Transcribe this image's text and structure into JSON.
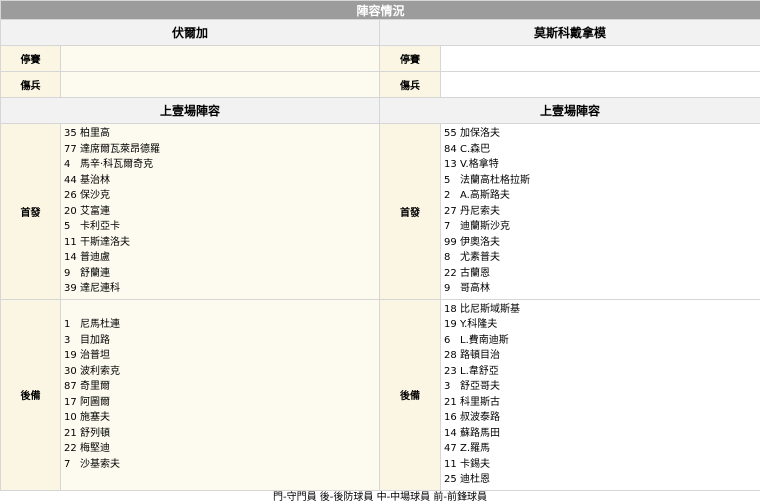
{
  "title": "陣容情況",
  "teams": {
    "home": "伏爾加",
    "away": "莫斯科戴拿模"
  },
  "labels": {
    "suspended": "停賽",
    "injured": "傷兵",
    "last_lineup": "上壹場陣容",
    "starters": "首發",
    "subs": "後備"
  },
  "home": {
    "suspended": "",
    "injured": "",
    "starters": [
      {
        "no": "35",
        "name": "柏里高"
      },
      {
        "no": "77",
        "name": "達席爾瓦萊昂德羅"
      },
      {
        "no": "4",
        "name": "馬辛·科瓦爾奇克"
      },
      {
        "no": "44",
        "name": "基治林"
      },
      {
        "no": "26",
        "name": "保沙克"
      },
      {
        "no": "20",
        "name": "艾富連"
      },
      {
        "no": "5",
        "name": "卡利亞卡"
      },
      {
        "no": "11",
        "name": "干斯達洛夫"
      },
      {
        "no": "14",
        "name": "普迪盧"
      },
      {
        "no": "9",
        "name": "舒蘭連"
      },
      {
        "no": "39",
        "name": "達尼連科"
      }
    ],
    "subs": [
      {
        "no": "1",
        "name": "尼馬杜連"
      },
      {
        "no": "3",
        "name": "目加路"
      },
      {
        "no": "19",
        "name": "治普坦"
      },
      {
        "no": "30",
        "name": "波利索克"
      },
      {
        "no": "87",
        "name": "奇里爾"
      },
      {
        "no": "17",
        "name": "阿圖爾"
      },
      {
        "no": "10",
        "name": "施塞夫"
      },
      {
        "no": "21",
        "name": "舒列頓"
      },
      {
        "no": "22",
        "name": "梅堅迪"
      },
      {
        "no": "7",
        "name": "沙基索夫"
      }
    ]
  },
  "away": {
    "suspended": "",
    "injured": "",
    "starters": [
      {
        "no": "55",
        "name": "加保洛夫"
      },
      {
        "no": "84",
        "name": "C.森巴"
      },
      {
        "no": "13",
        "name": "V.格拿特"
      },
      {
        "no": "5",
        "name": "法蘭高杜格拉斯"
      },
      {
        "no": "2",
        "name": "A.高斯路夫"
      },
      {
        "no": "27",
        "name": "丹尼索夫"
      },
      {
        "no": "7",
        "name": "迪蘭斯沙克"
      },
      {
        "no": "99",
        "name": "伊奧洛夫"
      },
      {
        "no": "8",
        "name": "尤素普夫"
      },
      {
        "no": "22",
        "name": "古蘭恩"
      },
      {
        "no": "9",
        "name": "哥高林"
      }
    ],
    "subs": [
      {
        "no": "18",
        "name": "比尼斯域斯基"
      },
      {
        "no": "19",
        "name": "Y.科隆夫"
      },
      {
        "no": "6",
        "name": "L.費南迪斯"
      },
      {
        "no": "28",
        "name": "路頓目治"
      },
      {
        "no": "23",
        "name": "L.韋舒亞"
      },
      {
        "no": "3",
        "name": "舒亞哥夫"
      },
      {
        "no": "21",
        "name": "科里斯古"
      },
      {
        "no": "16",
        "name": "叔波泰路"
      },
      {
        "no": "14",
        "name": "蘇路馬田"
      },
      {
        "no": "47",
        "name": "Z.羅馬"
      },
      {
        "no": "11",
        "name": "卡錫夫"
      },
      {
        "no": "25",
        "name": "迪杜恩"
      }
    ]
  },
  "legend": "門-守門員 後-後防球員 中-中場球員 前-前鋒球員"
}
